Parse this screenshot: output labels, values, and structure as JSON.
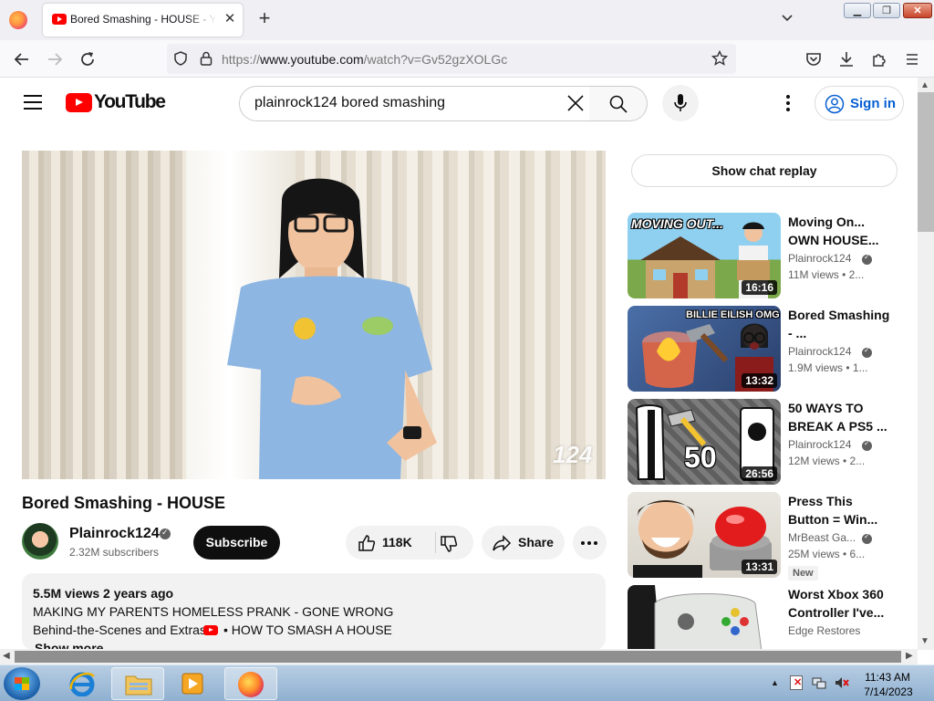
{
  "browser": {
    "tab_title": "Bored Smashing - HOUSE - YouTube",
    "url_prefix": "https://",
    "url_domain": "www.youtube.com",
    "url_path": "/watch?v=Gv52gzXOLGc"
  },
  "youtube": {
    "logo_text": "YouTube",
    "search_query": "plainrock124 bored smashing",
    "sign_in": "Sign in"
  },
  "video": {
    "watermark": "124",
    "title": "Bored Smashing - HOUSE",
    "channel": "Plainrock124",
    "subscribers": "2.32M subscribers",
    "subscribe": "Subscribe",
    "likes": "118K",
    "share": "Share",
    "meta": "5.5M views  2 years ago",
    "desc_line1": "MAKING MY PARENTS HOMELESS PRANK - GONE WRONG",
    "desc_line2": "Behind-the-Scenes and Extras!",
    "desc_link": "• HOW TO SMASH A HOUSE",
    "show_more": "Show more"
  },
  "sidebar": {
    "chat_replay": "Show chat replay",
    "recs": [
      {
        "title": "Moving On... OWN HOUSE...",
        "channel": "Plainrock124",
        "meta": "11M views  • 2...",
        "duration": "16:16",
        "thumb_text": "MOVING OUT...",
        "new": ""
      },
      {
        "title": "Bored Smashing - ...",
        "channel": "Plainrock124",
        "meta": "1.9M views  • 1...",
        "duration": "13:32",
        "thumb_text": "BILLIE EILISH OMG",
        "new": ""
      },
      {
        "title": "50 WAYS TO BREAK A PS5 ...",
        "channel": "Plainrock124",
        "meta": "12M views  • 2...",
        "duration": "26:56",
        "thumb_text": "50",
        "new": ""
      },
      {
        "title": "Press This Button = Win...",
        "channel": "MrBeast Ga...",
        "meta": "25M views  • 6...",
        "duration": "13:31",
        "thumb_text": "",
        "new": "New"
      },
      {
        "title": "Worst Xbox 360 Controller I've...",
        "channel": "Edge Restores",
        "meta": "",
        "duration": "",
        "thumb_text": "",
        "new": ""
      }
    ]
  },
  "taskbar": {
    "time": "11:43 AM",
    "date": "7/14/2023"
  }
}
